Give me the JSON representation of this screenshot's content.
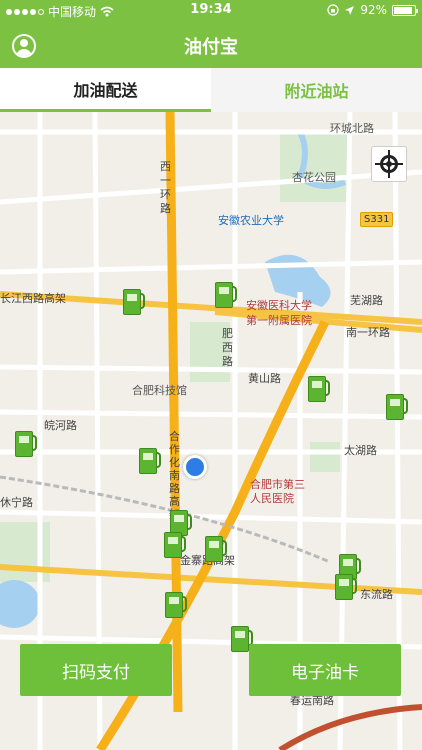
{
  "status_bar": {
    "carrier": "中国移动",
    "time": "19:34",
    "battery_percent": "92%",
    "battery_level": 0.92,
    "signal_icon": "signal-dots-icon",
    "wifi_icon": "wifi-icon",
    "lock_icon": "orientation-lock-icon",
    "location_icon": "location-arrow-icon"
  },
  "nav": {
    "title": "油付宝",
    "avatar_icon": "user-avatar-icon"
  },
  "tabs": [
    {
      "label": "加油配送",
      "active": true
    },
    {
      "label": "附近油站",
      "active": false
    }
  ],
  "map": {
    "labels": {
      "huancheng_north": "环城北路",
      "xinghua_park": "杏花公园",
      "xi_yi_huan": "西一环路",
      "anhui_agri_univ": "安徽农业大学",
      "s331": "S331",
      "changjiang_west": "长江西路高架",
      "anyi_line1": "安徽医科大学",
      "anyi_line2": "第一附属医院",
      "wuhu_road": "芜湖路",
      "feixi_road_1": "肥",
      "feixi_road_2": "西",
      "feixi_road_3": "路",
      "nanyi_huan": "南一环路",
      "huangshan_road": "黄山路",
      "hefei_sci_museum": "合肥科技馆",
      "wanhe_road": "皖河路",
      "taihu_road": "太湖路",
      "hezuohua_south": "合作化南路高架",
      "hefei_third_line1": "合肥市第三",
      "hefei_third_line2": "人民医院",
      "xiuning_road": "休宁路",
      "dongliu_road": "东流路",
      "jinzhai_road": "金寨路高架",
      "yunshui_road": "春运南路"
    },
    "station_icon": "gas-station-icon",
    "locate_icon": "locate-crosshair-icon",
    "my_location_icon": "current-location-icon"
  },
  "actions": {
    "scan_pay": "扫码支付",
    "e_card": "电子油卡"
  },
  "colors": {
    "brand_green": "#7dc142",
    "button_green": "#6ebf3a",
    "location_blue": "#2d7de6",
    "highway_yellow": "#f6c343"
  }
}
